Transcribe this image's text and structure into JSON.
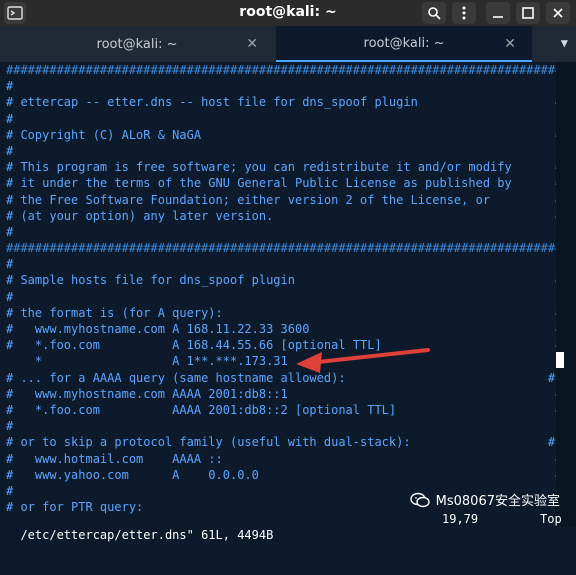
{
  "window": {
    "title": "root@kali: ~"
  },
  "tabs": [
    {
      "label": "root@kali: ~",
      "active": false
    },
    {
      "label": "root@kali: ~",
      "active": true
    }
  ],
  "terminal_lines": [
    "##############################################################################",
    "#                                                                            #",
    "# ettercap -- etter.dns -- host file for dns_spoof plugin                   #",
    "#                                                                            #",
    "# Copyright (C) ALoR & NaGA                                                 #",
    "#                                                                            #",
    "# This program is free software; you can redistribute it and/or modify      #",
    "# it under the terms of the GNU General Public License as published by      #",
    "# the Free Software Foundation; either version 2 of the License, or         #",
    "# (at your option) any later version.                                       #",
    "#                                                                            #",
    "##############################################################################",
    "#                                                                            #",
    "# Sample hosts file for dns_spoof plugin                                    #",
    "#                                                                            #",
    "# the format is (for A query):                                              #",
    "#   www.myhostname.com A 168.11.22.33 3600                                  #",
    "#   *.foo.com          A 168.44.55.66 [optional TTL]                        #",
    "    *                  A 1**.***.173.31",
    "# ... for a AAAA query (same hostname allowed):                            #",
    "#   www.myhostname.com AAAA 2001:db8::1                                     #",
    "#   *.foo.com          AAAA 2001:db8::2 [optional TTL]                      #",
    "#                                                                            #",
    "# or to skip a protocol family (useful with dual-stack):                   #",
    "#   www.hotmail.com    AAAA ::                                              #",
    "#   www.yahoo.com      A    0.0.0.0                                         #",
    "#                                                                            #",
    "# or for PTR query:"
  ],
  "status": {
    "file": "/etc/ettercap/etter.dns\" 61L, 4494B",
    "position": "19,79",
    "scroll": "Top"
  },
  "watermark": {
    "text": "Ms08067安全实验室"
  }
}
